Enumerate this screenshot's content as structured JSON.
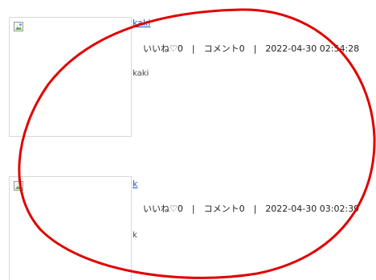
{
  "posts": [
    {
      "author": "kaki",
      "likes_label": "いいね♡0",
      "separator": "|",
      "comments_label": "コメント0",
      "timestamp": "2022-04-30 02:54:28",
      "body": "kaki",
      "image_icon": "broken-image-icon"
    },
    {
      "author": "k",
      "likes_label": "いいね♡0",
      "separator": "|",
      "comments_label": "コメント0",
      "timestamp": "2022-04-30 03:02:39",
      "body": "k",
      "image_icon": "broken-image-icon"
    }
  ],
  "colors": {
    "link": "#1a55d4",
    "annotation_ring": "#e00000"
  }
}
